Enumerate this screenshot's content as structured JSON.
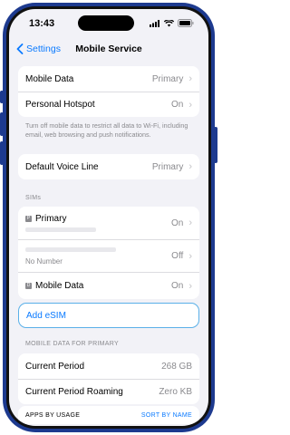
{
  "status": {
    "time": "13:43"
  },
  "nav": {
    "back_label": "Settings",
    "title": "Mobile Service"
  },
  "group1": {
    "mobile_data": {
      "label": "Mobile Data",
      "value": "Primary"
    },
    "hotspot": {
      "label": "Personal Hotspot",
      "value": "On"
    }
  },
  "note": "Turn off mobile data to restrict all data to Wi-Fi, including email, web browsing and push notifications.",
  "voice": {
    "label": "Default Voice Line",
    "value": "Primary"
  },
  "sims": {
    "header": "SIMs",
    "primary": {
      "tag": "P",
      "label": "Primary",
      "value": "On"
    },
    "second": {
      "sublabel": "No Number",
      "value": "Off"
    },
    "mobile_data": {
      "tag": "D",
      "label": "Mobile Data",
      "value": "On"
    }
  },
  "add_esim": "Add eSIM",
  "usage": {
    "header": "MOBILE DATA FOR PRIMARY",
    "current": {
      "label": "Current Period",
      "value": "268 GB"
    },
    "roaming": {
      "label": "Current Period Roaming",
      "value": "Zero KB"
    }
  },
  "apps": {
    "header": "APPS BY USAGE",
    "sort": "SORT BY NAME"
  },
  "colors": {
    "accent": "#0a7aff",
    "frame": "#1d3a8f",
    "background": "#f2f2f7"
  }
}
